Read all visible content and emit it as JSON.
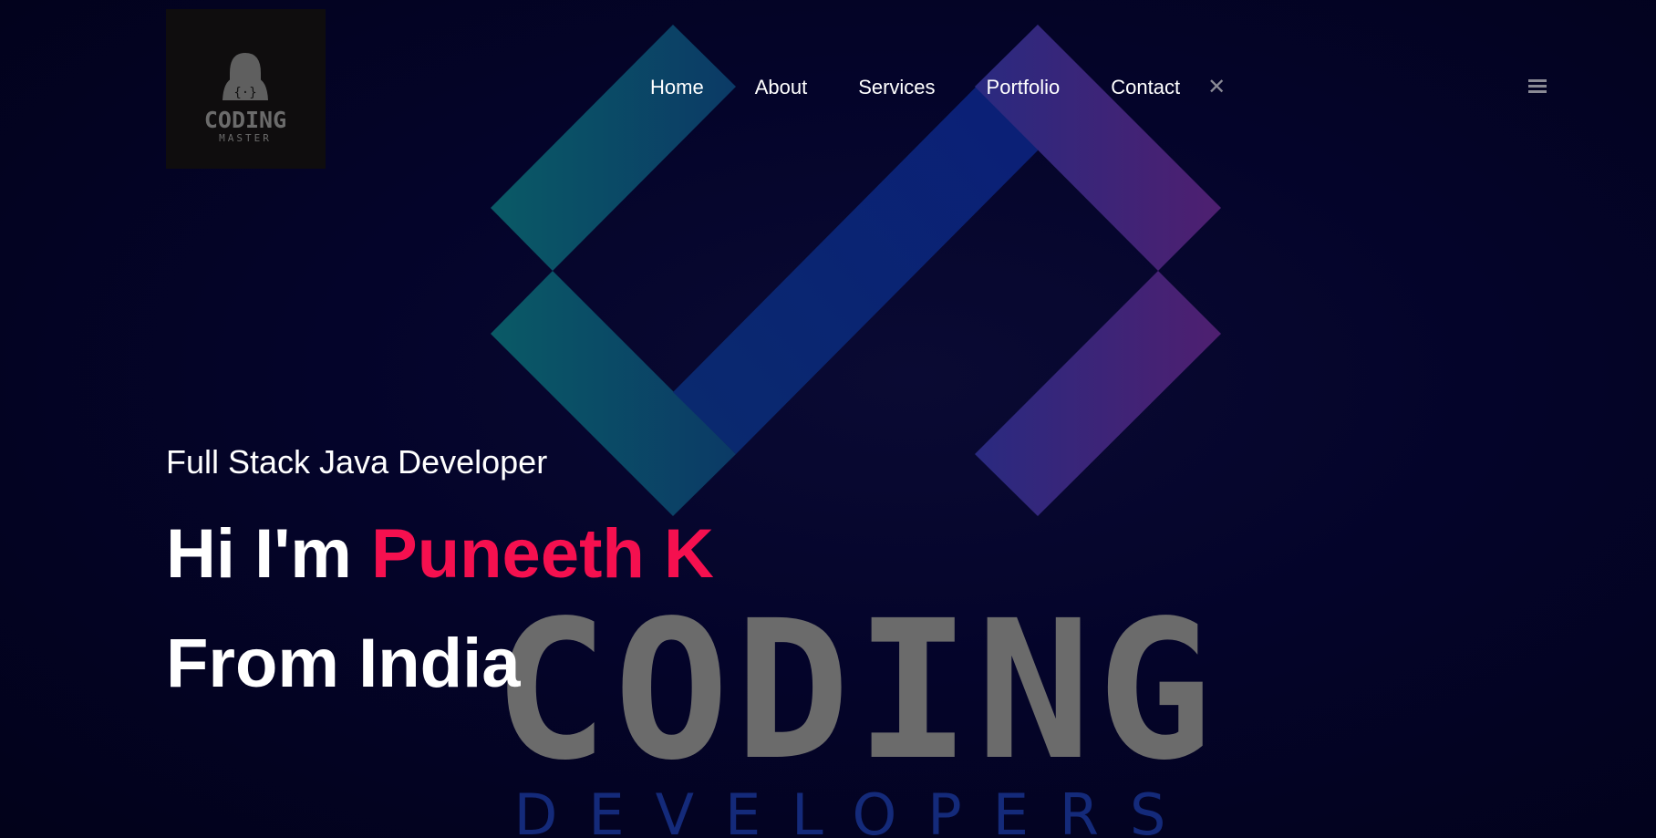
{
  "header": {
    "logo": {
      "icon": "hooded-coder-icon",
      "text_line1": "CODING",
      "text_line2": "MASTER"
    },
    "nav": [
      {
        "label": "Home"
      },
      {
        "label": "About"
      },
      {
        "label": "Services"
      },
      {
        "label": "Portfolio"
      },
      {
        "label": "Contact"
      }
    ],
    "close_icon": "close-icon",
    "menu_icon": "hamburger-menu-icon"
  },
  "hero": {
    "subtitle": "Full Stack Java Developer",
    "greeting": "Hi I'm",
    "name": "Puneeth K",
    "location_line": "From India"
  },
  "background": {
    "brand_text": "CODING",
    "brand_subtext": "DEVELOPERS"
  },
  "colors": {
    "background": "#03031f",
    "accent": "#f5104f",
    "nav_text": "#ffffff",
    "icon_gray": "#8a8a95"
  }
}
